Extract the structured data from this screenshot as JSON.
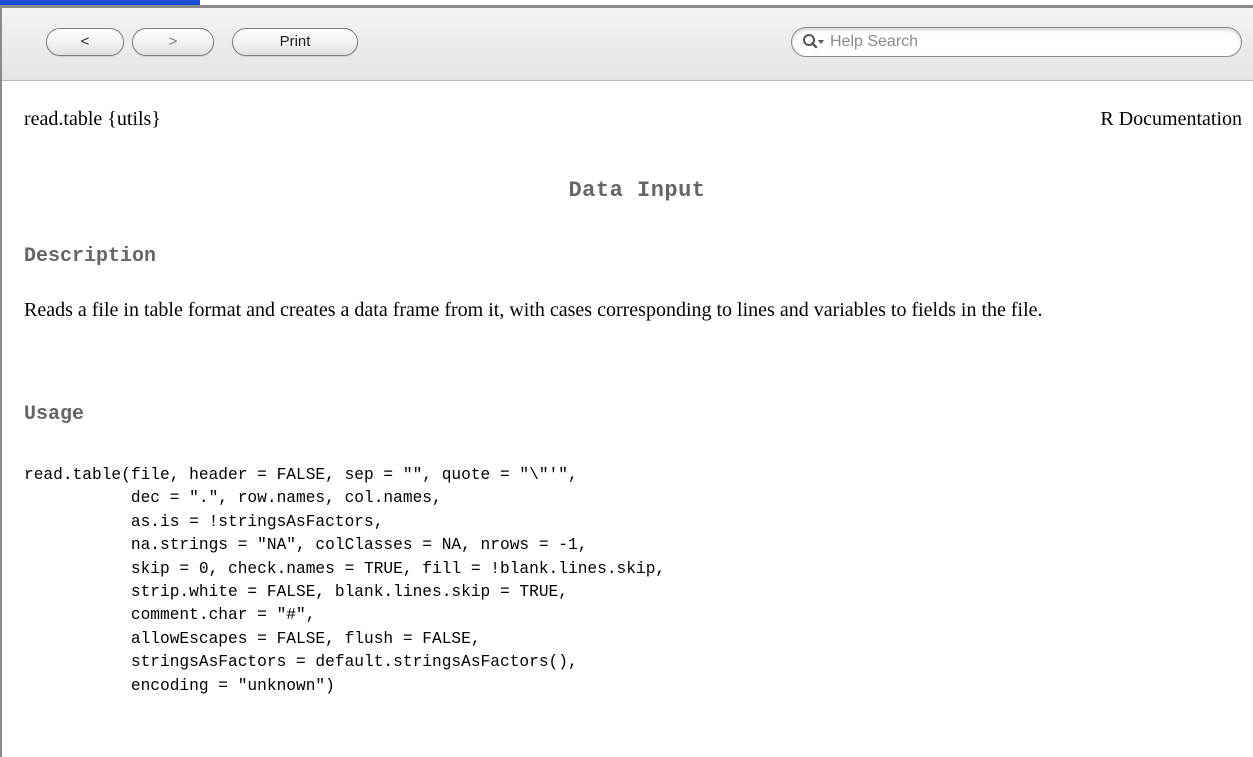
{
  "toolbar": {
    "back_label": "<",
    "forward_label": ">",
    "print_label": "Print",
    "search_placeholder": "Help Search",
    "search_value": ""
  },
  "doc": {
    "topic": "read.table {utils}",
    "source": "R Documentation",
    "title": "Data Input",
    "sections": {
      "description": {
        "heading": "Description",
        "text": "Reads a file in table format and creates a data frame from it, with cases corresponding to lines and variables to fields in the file."
      },
      "usage": {
        "heading": "Usage",
        "code": "read.table(file, header = FALSE, sep = \"\", quote = \"\\\"'\",\n           dec = \".\", row.names, col.names,\n           as.is = !stringsAsFactors,\n           na.strings = \"NA\", colClasses = NA, nrows = -1,\n           skip = 0, check.names = TRUE, fill = !blank.lines.skip,\n           strip.white = FALSE, blank.lines.skip = TRUE,\n           comment.char = \"#\",\n           allowEscapes = FALSE, flush = FALSE,\n           stringsAsFactors = default.stringsAsFactors(),\n           encoding = \"unknown\")"
      }
    }
  },
  "colors": {
    "link_bar": "#1a4fd6",
    "section_heading": "#666666",
    "toolbar_bg": "#e8e8e8"
  }
}
